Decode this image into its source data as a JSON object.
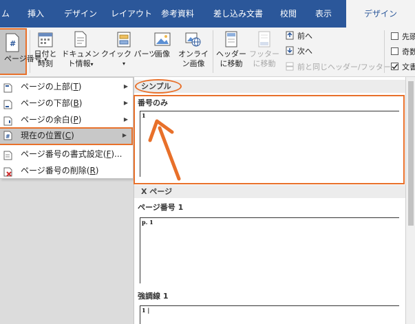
{
  "tabs": [
    "ム",
    "挿入",
    "デザイン",
    "レイアウト",
    "参考資料",
    "差し込み文書",
    "校閲",
    "表示",
    "デザイン"
  ],
  "ribbon": {
    "page_number": "ページ番号",
    "page_number_arrow": "▾",
    "date_time": "日付と時刻",
    "doc_info": "ドキュメント情報",
    "doc_info_arrow": "▾",
    "quick_parts": "クイック パーツ",
    "quick_parts_arrow": "▾",
    "picture": "画像",
    "online_picture": "オンライン画像",
    "go_to_header": "ヘッダーに移動",
    "go_to_footer": "フッターに移動",
    "previous": "前へ",
    "next": "次へ",
    "link_previous": "前と同じヘッダー/フッター",
    "check_first": "先頭",
    "check_odd": "奇数",
    "check_text": "文書"
  },
  "menu": {
    "items": [
      {
        "label": "ページの上部(",
        "key": "T",
        "suffix": ")",
        "arrow": "▶"
      },
      {
        "label": "ページの下部(",
        "key": "B",
        "suffix": ")",
        "arrow": "▶"
      },
      {
        "label": "ページの余白(",
        "key": "P",
        "suffix": ")",
        "arrow": "▶"
      },
      {
        "label": "現在の位置(",
        "key": "C",
        "suffix": ")",
        "arrow": "▶"
      },
      {
        "label": "ページ番号の書式設定(",
        "key": "F",
        "suffix": ")..."
      },
      {
        "label": "ページ番号の削除(",
        "key": "R",
        "suffix": ")"
      }
    ]
  },
  "gallery": {
    "section_simple": "シンプル",
    "item1_title": "番号のみ",
    "item1_text": "1",
    "section_xpage": "X ページ",
    "item2_title": "ページ番号 1",
    "item2_text": "p. 1",
    "item3_title": "強調線 1",
    "item3_text": "1 |"
  },
  "colors": {
    "word_blue": "#2b579a",
    "highlight_orange": "#e8702a"
  }
}
